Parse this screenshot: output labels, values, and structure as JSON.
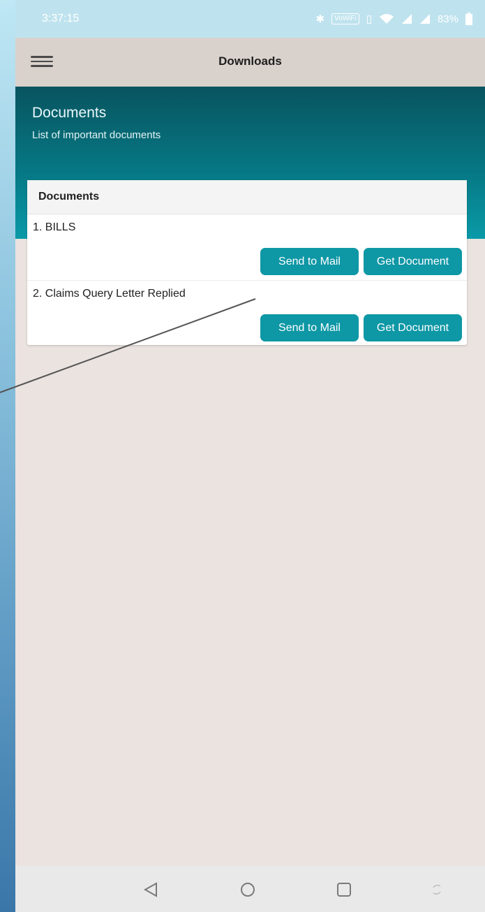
{
  "status_bar": {
    "time": "3:37:15",
    "wifi_badge": "VoWiFi",
    "battery": "83%"
  },
  "app_bar": {
    "title": "Downloads",
    "menu_icon": "hamburger-menu-icon"
  },
  "hero": {
    "title": "Documents",
    "subtitle": "List of important documents"
  },
  "card": {
    "header": "Documents",
    "documents": [
      {
        "name": "1.  BILLS",
        "send_label": "Send to Mail",
        "get_label": "Get Document"
      },
      {
        "name": "2.  Claims Query Letter Replied",
        "send_label": "Send to Mail",
        "get_label": "Get Document"
      }
    ]
  },
  "nav_bar": {
    "items": [
      "back-triangle-icon",
      "home-circle-icon",
      "recents-square-icon",
      "rotate-icon"
    ]
  },
  "colors": {
    "accent": "#0e97a5",
    "hero_dark": "#08545f",
    "background": "#eae3df"
  }
}
